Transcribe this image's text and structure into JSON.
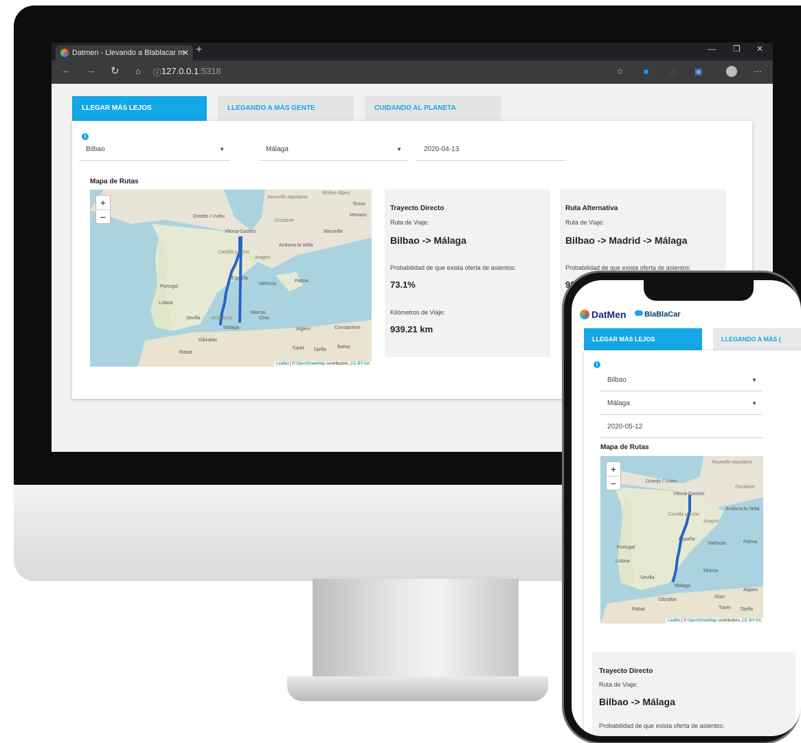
{
  "browser": {
    "tab_title": "Datmen - Llevando a Blablacar m",
    "close_glyph": "✕",
    "new_tab_glyph": "+",
    "url_host": "127.0.0.1",
    "url_port": ":5318",
    "window_controls": [
      "—",
      "❐",
      "✕"
    ]
  },
  "app": {
    "tabs": [
      {
        "label": "LLEGAR MÁS LEJOS",
        "active": true
      },
      {
        "label": "LLEGANDO A MÁS GENTE",
        "active": false
      },
      {
        "label": "CUIDANDO AL PLANETA",
        "active": false
      }
    ],
    "origin": "Bilbao",
    "destination": "Málaga",
    "date": "2020-04-13",
    "map_title": "Mapa de Rutas",
    "zoom_in": "+",
    "zoom_out": "−",
    "attribution_leaflet": "Leaflet",
    "attribution_mid": " | © ",
    "attribution_osm": "OpenStreetMap",
    "attribution_rest": " contributors, ",
    "attribution_license": "CC-BY-SA",
    "map_labels": [
      "Nouvelle-Aquitaine",
      "Rhône-Alpes",
      "Torino",
      "Monaco",
      "Oviedo / Uviéu",
      "Occitanie",
      "Marseille",
      "Vitoria-Gasteiz",
      "Andorra la Vella",
      "Castilla y León",
      "Aragón",
      "España",
      "Portugal",
      "València",
      "Palma",
      "Lisboa",
      "Murcia",
      "Sevilla",
      "Andalucía",
      "Málaga",
      "Oran",
      "Algiers",
      "Constantine",
      "Gibraltar",
      "Rabat",
      "Tiaret",
      "Djelfa",
      "Batna"
    ],
    "direct": {
      "title": "Trayecto Directo",
      "route_label": "Ruta de Viaje:",
      "route": "Bilbao -> Málaga",
      "prob_label": "Probabilidad de que exista oferta de asientos:",
      "prob": "73.1%",
      "km_label": "Kilómetros de Viaje:",
      "km": "939.21 km"
    },
    "alternative": {
      "title": "Ruta Alternativa",
      "route_label": "Ruta de Viaje:",
      "route": "Bilbao -> Madrid -> Málaga",
      "prob_label": "Probabilidad de que exista oferta de asientos:",
      "prob_partial": "98"
    }
  },
  "mobile": {
    "brand": "DatMen",
    "partner": "BlaBlaCar",
    "tabs": [
      {
        "label": "LLEGAR MÁS LEJOS",
        "active": true
      },
      {
        "label": "LLEGANDO A MÁS (",
        "active": false
      }
    ],
    "origin": "Bilbao",
    "destination": "Málaga",
    "date": "2020-05-12",
    "map_title": "Mapa de Rutas",
    "direct": {
      "title": "Trayecto Directo",
      "route_label": "Ruta de Viaje:",
      "route": "Bilbao -> Málaga",
      "prob_label": "Probabilidad de que exista oferta de asientos:"
    }
  },
  "colors": {
    "accent": "#14a7e5",
    "route_line": "#2962c9"
  }
}
